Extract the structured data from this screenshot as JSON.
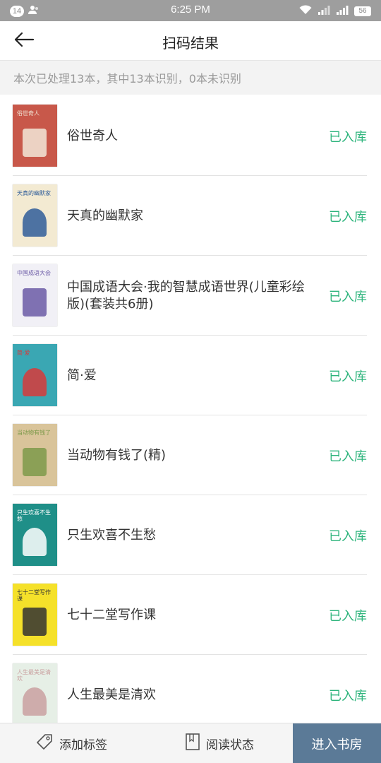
{
  "status_bar": {
    "notification_count": "14",
    "time": "6:25 PM",
    "battery": "56"
  },
  "header": {
    "title": "扫码结果"
  },
  "summary": "本次已处理13本，其中13本识别，0本未识别",
  "books": [
    {
      "title": "俗世奇人",
      "status": "已入库",
      "cover": {
        "bg": "#c8584a",
        "accent": "#f2e8d8",
        "label": "俗世奇人"
      }
    },
    {
      "title": "天真的幽默家",
      "status": "已入库",
      "cover": {
        "bg": "#f3ead2",
        "accent": "#2f5d9a",
        "label": "天真的幽默家"
      }
    },
    {
      "title": "中国成语大会·我的智慧成语世界(儿童彩绘版)(套装共6册)",
      "status": "已入库",
      "cover": {
        "bg": "#f1f0f6",
        "accent": "#6b5aa6",
        "label": "中国成语大会"
      }
    },
    {
      "title": "简·爱",
      "status": "已入库",
      "cover": {
        "bg": "#3aa7b3",
        "accent": "#d83a3a",
        "label": "简·爱"
      }
    },
    {
      "title": "当动物有钱了(精)",
      "status": "已入库",
      "cover": {
        "bg": "#d9c49a",
        "accent": "#7d9a4a",
        "label": "当动物有钱了"
      }
    },
    {
      "title": "只生欢喜不生愁",
      "status": "已入库",
      "cover": {
        "bg": "#1f8f88",
        "accent": "#ffffff",
        "label": "只生欢喜不生愁"
      }
    },
    {
      "title": "七十二堂写作课",
      "status": "已入库",
      "cover": {
        "bg": "#f5e12a",
        "accent": "#333333",
        "label": "七十二堂写作课"
      }
    },
    {
      "title": "人生最美是清欢",
      "status": "已入库",
      "cover": {
        "bg": "#e6efe6",
        "accent": "#c9a0a0",
        "label": "人生最美是清欢"
      }
    }
  ],
  "bottom_bar": {
    "add_tags": "添加标签",
    "reading_status": "阅读状态",
    "enter_library": "进入书房"
  },
  "colors": {
    "status_green": "#2db47c",
    "primary_button": "#5b7a97",
    "status_bar": "#9e9e9e"
  },
  "icons": {
    "back": "arrow-left-icon",
    "tag": "tag-icon",
    "book": "book-icon",
    "wifi": "wifi-icon",
    "signal": "signal-icon",
    "battery": "battery-icon"
  }
}
